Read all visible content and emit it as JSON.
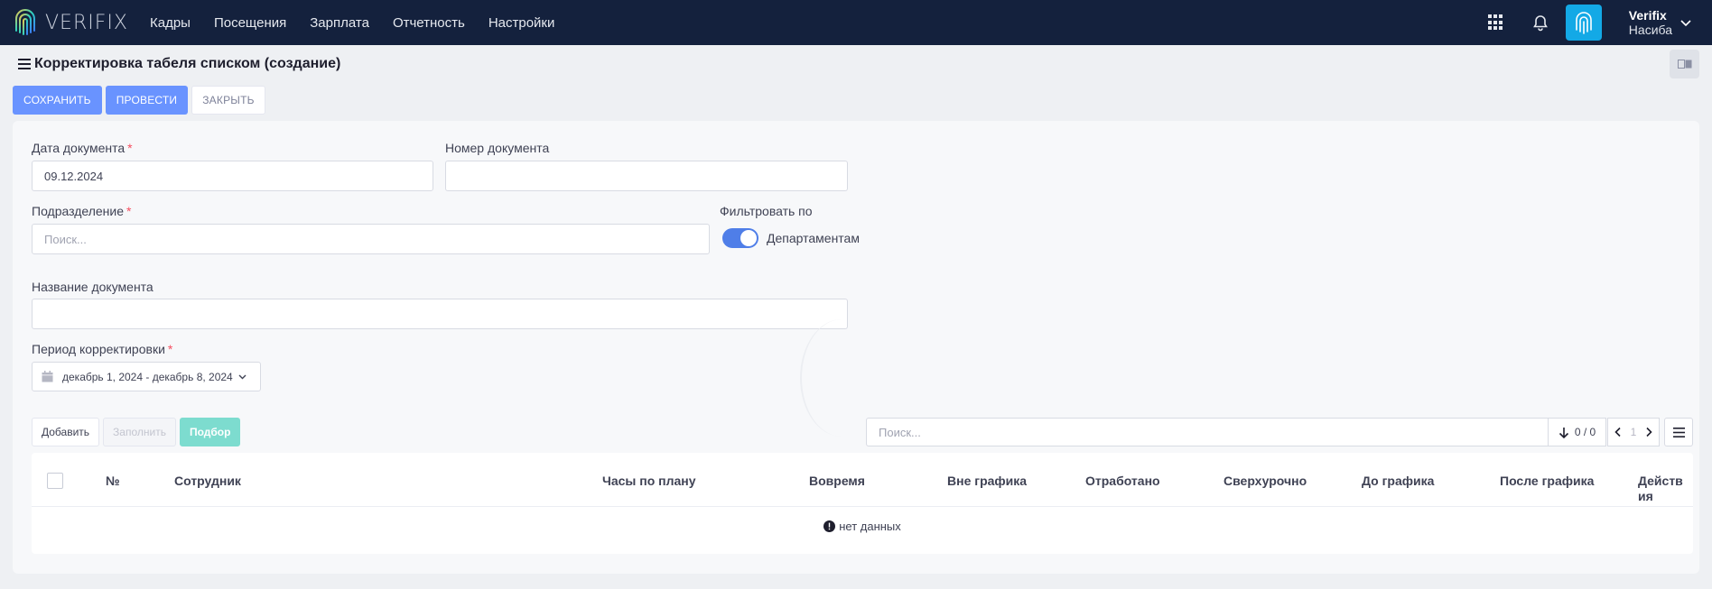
{
  "brand": {
    "name": "VERIFIX"
  },
  "nav": [
    {
      "label": "Кадры"
    },
    {
      "label": "Посещения"
    },
    {
      "label": "Зарплата"
    },
    {
      "label": "Отчетность"
    },
    {
      "label": "Настройки"
    }
  ],
  "user": {
    "name": "Verifix",
    "sub": "Насиба"
  },
  "page": {
    "title": "Корректировка табеля списком (создание)"
  },
  "actions": {
    "save": "СОХРАНИТЬ",
    "post": "ПРОВЕСТИ",
    "close": "ЗАКРЫТЬ"
  },
  "form": {
    "doc_date_label": "Дата документа",
    "doc_date_value": "09.12.2024",
    "doc_number_label": "Номер документа",
    "doc_number_value": "",
    "division_label": "Подразделение",
    "division_placeholder": "Поиск...",
    "filter_label": "Фильтровать по",
    "filter_toggle_label": "Департаментам",
    "filter_toggle_on": true,
    "doc_name_label": "Название документа",
    "doc_name_value": "",
    "period_label": "Период корректировки",
    "period_value": "декабрь 1, 2024 - декабрь 8, 2024"
  },
  "table_actions": {
    "add": "Добавить",
    "fill": "Заполнить",
    "pick": "Подбор"
  },
  "grid": {
    "search_placeholder": "Поиск...",
    "counter": "0 / 0",
    "page": "1",
    "columns": [
      "№",
      "Сотрудник",
      "Часы по плану",
      "Вовремя",
      "Вне графика",
      "Отработано",
      "Сверхурочно",
      "До графика",
      "После графика",
      "Действия"
    ],
    "empty_text": "нет данных"
  },
  "colors": {
    "topbar": "#14213d",
    "primary": "#6993ff",
    "teal": "#7ddccf",
    "toggle": "#4f7ee8"
  }
}
